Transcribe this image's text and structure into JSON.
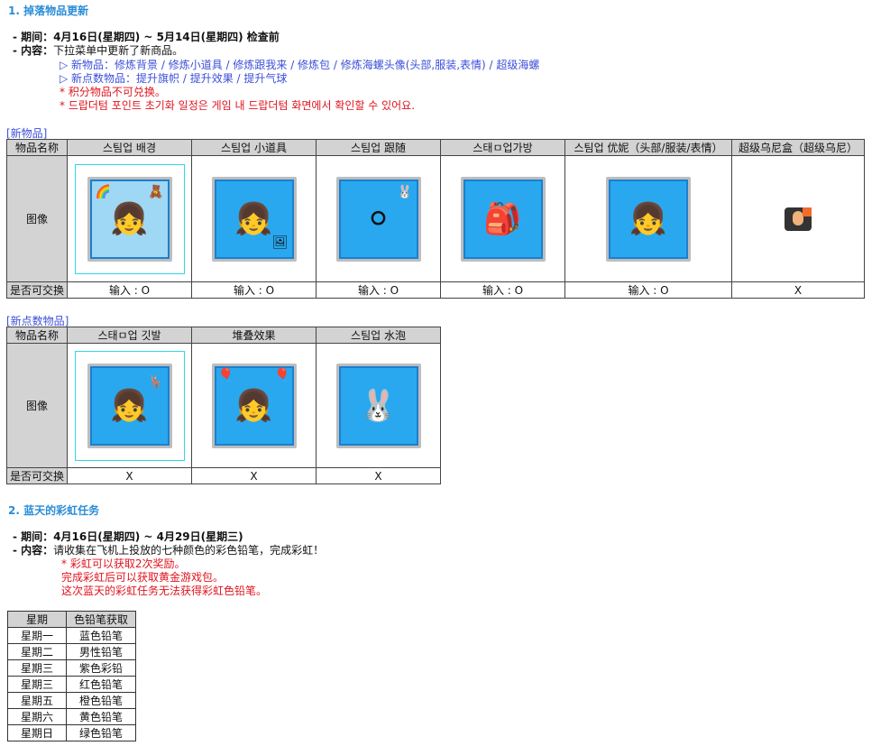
{
  "section1": {
    "title": "1. 掉落物品更新",
    "period_label": "- 期间：",
    "period_value": "4月16日(星期四) ~ 5月14日(星期四) 检查前",
    "content_label": "- 内容：",
    "content_value": "下拉菜单中更新了新商品。",
    "new_items_line": "▷ 新物品：修炼背景 / 修炼小道具 / 修炼跟我来 / 修炼包 / 修炼海螺头像(头部,服装,表情) / 超级海螺",
    "new_points_line": "▷ 新点数物品：提升旗帜 / 提升效果 / 提升气球",
    "note1": "* 积分物品不可兑换。",
    "note2": "* 드랍더텀 포인트 초기화 일정은 게임 내 드랍더텀 화면에서 확인할 수 있어요."
  },
  "table1": {
    "tag": "[新物品]",
    "header_label": "物品名称",
    "image_label": "图像",
    "exchange_label": "是否可交换",
    "columns": [
      {
        "name": "스팀업 배경",
        "exchange": "输入 : O",
        "icon": "room-background-icon"
      },
      {
        "name": "스팀업 小道具",
        "exchange": "输入 : O",
        "icon": "prop-icon"
      },
      {
        "name": "스팀업 跟随",
        "exchange": "输入 : O",
        "icon": "follower-icon"
      },
      {
        "name": "스태ㅁ업가방",
        "exchange": "输入 : O",
        "icon": "backpack-icon"
      },
      {
        "name": "스팀업 优妮（头部/服装/表情）",
        "exchange": "输入 : O",
        "icon": "avatar-outfit-icon"
      },
      {
        "name": "超级乌尼盒（超级乌尼）",
        "exchange": "X",
        "icon": "super-box-icon"
      }
    ]
  },
  "table2": {
    "tag": "[新点数物品]",
    "header_label": "物品名称",
    "image_label": "图像",
    "exchange_label": "是否可交换",
    "columns": [
      {
        "name": "스태ㅁ업 깃발",
        "exchange": "X",
        "icon": "flag-icon"
      },
      {
        "name": "堆叠效果",
        "exchange": "X",
        "icon": "stack-effect-icon"
      },
      {
        "name": "스팀업 水泡",
        "exchange": "X",
        "icon": "bubble-icon"
      }
    ]
  },
  "section2": {
    "title": "2. 蓝天的彩虹任务",
    "period_label": "- 期间：",
    "period_value": "4月16日(星期四) ~ 4月29日(星期三)",
    "content_label": "- 内容：",
    "content_value": "请收集在飞机上投放的七种颜色的彩色铅笔，完成彩虹！",
    "note1": "* 彩虹可以获取2次奖励。",
    "note2": "完成彩虹后可以获取黄金游戏包。",
    "note3": "这次蓝天的彩虹任务无法获得彩虹色铅笔。"
  },
  "table3": {
    "col1": "星期",
    "col2": "色铅笔获取",
    "rows": [
      {
        "day": "星期一",
        "item": "蓝色铅笔"
      },
      {
        "day": "星期二",
        "item": "男性铅笔"
      },
      {
        "day": "星期三",
        "item": "紫色彩铅"
      },
      {
        "day": "星期三",
        "item": "红色铅笔"
      },
      {
        "day": "星期五",
        "item": "橙色铅笔"
      },
      {
        "day": "星期六",
        "item": "黄色铅笔"
      },
      {
        "day": "星期日",
        "item": "绿色铅笔"
      }
    ]
  }
}
